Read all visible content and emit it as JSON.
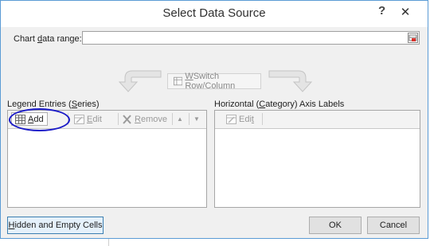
{
  "window": {
    "title": "Select Data Source",
    "help": "?",
    "close": "✕"
  },
  "chart_range": {
    "label_pre": "Chart ",
    "label_key": "d",
    "label_post": "ata range:",
    "value": ""
  },
  "switch_button": {
    "key": "W",
    "rest": "Switch Row/Column"
  },
  "legend": {
    "label_pre": "Legend Entries (",
    "label_key": "S",
    "label_post": "eries)",
    "add_key": "A",
    "add_rest": "dd",
    "edit_key": "E",
    "edit_rest": "dit",
    "remove_key": "R",
    "remove_rest": "emove",
    "up": "▲",
    "down": "▼",
    "items": []
  },
  "axis": {
    "label_pre": "Horizontal (",
    "label_key": "C",
    "label_post": "ategory) Axis Labels",
    "edit_pre": "Edi",
    "edit_key": "t",
    "items": []
  },
  "footer": {
    "hidden_key": "H",
    "hidden_rest": "idden and Empty Cells",
    "ok": "OK",
    "cancel": "Cancel"
  },
  "colors": {
    "accent_border": "#5b9bd5",
    "annotation_oval": "#1a1ac8"
  }
}
